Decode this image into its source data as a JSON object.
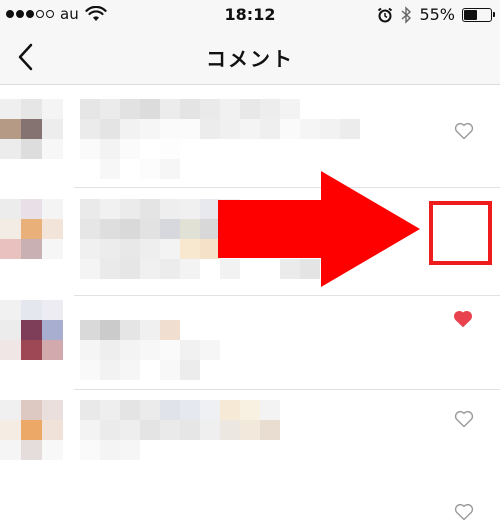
{
  "status_bar": {
    "carrier": "au",
    "time": "18:12",
    "battery_label": "55%",
    "battery_level": 0.55
  },
  "nav": {
    "title": "コメント",
    "back_icon": "chevron-left-icon"
  },
  "comments": [
    {
      "liked": false,
      "like_icon": "heart-outline-icon"
    },
    {
      "liked": true,
      "like_icon": "heart-filled-icon"
    },
    {
      "liked": false,
      "like_icon": "heart-outline-icon"
    },
    {
      "liked": false,
      "like_icon": "heart-outline-icon"
    }
  ],
  "annotation": {
    "arrow_color": "#ff0000",
    "highlight_color": "#ee1c1c"
  },
  "colors": {
    "heart_liked": "#e8424f",
    "heart_outline": "#9a9a9a"
  }
}
